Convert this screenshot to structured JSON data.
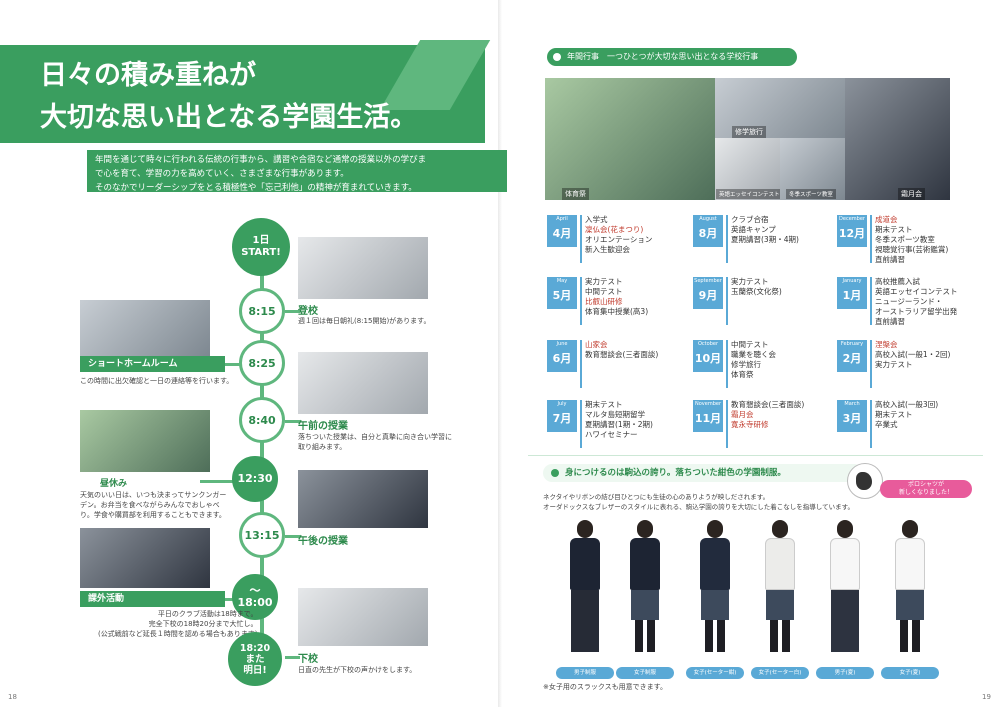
{
  "left": {
    "hero_title": [
      "日々の積み重ねが",
      "大切な思い出となる学園生活。"
    ],
    "intro": [
      "年間を通じて時々に行われる伝統の行事から、講習や合宿など通常の授業以外の学びま",
      "で心を育て、学習の力を高めていく、さまざまな行事があります。",
      "そのなかでリーダーシップをとる積極性や「忘己利他」の精神が育まれていきます。"
    ],
    "start_node": [
      "1日",
      "START!"
    ],
    "end_node": [
      "18:20",
      "また",
      "明日!"
    ],
    "schedule": [
      {
        "time": "8:15",
        "title": "登校",
        "desc": [
          "週１回は毎日朝礼(8:15開始)があります。"
        ]
      },
      {
        "time": "8:25",
        "title": "ショートホームルーム",
        "desc": [
          "この時間に出欠確認と一日の連絡等を行います。"
        ]
      },
      {
        "time": "8:40",
        "title": "午前の授業",
        "desc": [
          "落ちついた授業は、自分と真摯に向き合い学習に",
          "取り組みます。"
        ]
      },
      {
        "time": "12:30",
        "title": "昼休み",
        "desc": [
          "天気のいい日は、いつも決まってサンクンガー",
          "デン。お弁当を食べながらみんなでおしゃべ",
          "り。学食や購買部を利用することもできます。"
        ]
      },
      {
        "time": "13:15",
        "title": "午後の授業",
        "desc": []
      },
      {
        "time": "〜18:00",
        "title": "課外活動",
        "desc": [
          "平日のクラブ活動は18時まで。",
          "完全下校の18時20分まで大忙し。",
          "(公式戦前など延長１時間を認める場合もあります)"
        ]
      },
      {
        "time": "",
        "title": "下校",
        "desc": [
          "日直の先生が下校の声かけをします。"
        ]
      }
    ],
    "page_number": "18"
  },
  "right": {
    "events_header": "年間行事　一つひとつが大切な思い出となる学校行事",
    "photo_labels": [
      "体育祭",
      "修学旅行",
      "英語エッセイコンテスト",
      "冬季スポーツ教室",
      "霜月会"
    ],
    "months": [
      {
        "en": "April",
        "jp": "4月",
        "events": [
          "入学式",
          "凜仏会(花まつり)",
          "オリエンテーション",
          "新入生歓迎会"
        ],
        "red": [
          1
        ]
      },
      {
        "en": "May",
        "jp": "5月",
        "events": [
          "実力テスト",
          "中間テスト",
          "比叡山研修",
          "体育集中授業(高3)"
        ],
        "red": [
          2
        ]
      },
      {
        "en": "June",
        "jp": "6月",
        "events": [
          "山家会",
          "教育懇談会(三者面談)"
        ],
        "red": [
          0
        ]
      },
      {
        "en": "July",
        "jp": "7月",
        "events": [
          "期末テスト",
          "マルタ島短期留学",
          "夏期講習(1期・2期)",
          "ハワイセミナー"
        ],
        "red": []
      },
      {
        "en": "August",
        "jp": "8月",
        "events": [
          "クラブ合宿",
          "英語キャンプ",
          "夏期講習(3期・4期)"
        ],
        "red": []
      },
      {
        "en": "September",
        "jp": "9月",
        "events": [
          "実力テスト",
          "玉蘭祭(文化祭)"
        ],
        "red": []
      },
      {
        "en": "October",
        "jp": "10月",
        "events": [
          "中間テスト",
          "職業を聴く会",
          "修学旅行",
          "体育祭"
        ],
        "red": []
      },
      {
        "en": "November",
        "jp": "11月",
        "events": [
          "教育懇談会(三者面談)",
          "霜月会",
          "寛永寺研修"
        ],
        "red": [
          1,
          2
        ]
      },
      {
        "en": "December",
        "jp": "12月",
        "events": [
          "成道会",
          "期末テスト",
          "冬季スポーツ教室",
          "視聴覚行事(芸術鑑賞)",
          "直前講習"
        ],
        "red": [
          0
        ]
      },
      {
        "en": "January",
        "jp": "1月",
        "events": [
          "高校推薦入試",
          "英語エッセイコンテスト",
          "ニュージーランド・",
          "オーストラリア留学出発",
          "直前講習"
        ],
        "red": []
      },
      {
        "en": "February",
        "jp": "2月",
        "events": [
          "涅槃会",
          "高校入試(一般1・2回)",
          "実力テスト"
        ],
        "red": [
          0
        ]
      },
      {
        "en": "March",
        "jp": "3月",
        "events": [
          "高校入試(一般3回)",
          "期末テスト",
          "卒業式"
        ],
        "red": []
      }
    ],
    "uniform_title": "身につけるのは駒込の誇り。落ちついた紺色の学園制服。",
    "uniform_desc": [
      "ネクタイやリボンの結び目ひとつにも生徒の心のありようが映しだされます。",
      "オーダドックスなブレザーのスタイルに表れる、駒込学園の誇りを大切にした着こなしを指導しています。"
    ],
    "callout": [
      "ポロシャツが",
      "新しくなりました！"
    ],
    "uniform_tags": [
      "男子制服",
      "女子制服",
      "女子(セーター紺)",
      "女子(セーター白)",
      "男子(夏)",
      "女子(夏)"
    ],
    "uniform_note": "※女子用のスラックスも用意できます。",
    "page_number": "19"
  }
}
